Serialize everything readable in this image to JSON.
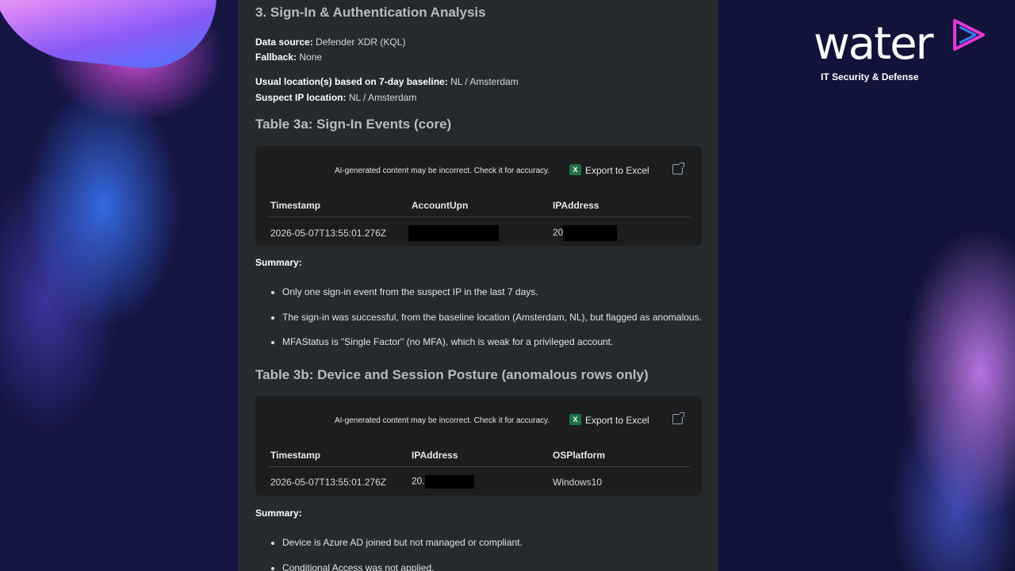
{
  "brand": {
    "wordmark": "water",
    "tagline": "IT Security & Defense",
    "colors": {
      "magenta": "#e33ad6",
      "blue": "#3a7bff"
    }
  },
  "report": {
    "section_title": "3. Sign-In & Authentication Analysis",
    "data_source": {
      "label": "Data source:",
      "value": "Defender XDR (KQL)"
    },
    "fallback": {
      "label": "Fallback:",
      "value": "None"
    },
    "usual_location": {
      "label": "Usual location(s) based on 7-day baseline:",
      "value": "NL / Amsterdam"
    },
    "suspect_location": {
      "label": "Suspect IP location:",
      "value": "NL / Amsterdam"
    },
    "table_a": {
      "title": "Table 3a: Sign-In Events (core)",
      "ai_note": "AI-generated content may be incorrect. Check it for accuracy.",
      "export_label": "Export to Excel",
      "columns": [
        "Timestamp",
        "AccountUpn",
        "IPAddress"
      ],
      "rows": [
        {
          "timestamp": "2026-05-07T13:55:01.276Z",
          "ip_prefix": "20"
        }
      ]
    },
    "summary_a": {
      "label": "Summary:",
      "items": [
        "Only one sign-in event from the suspect IP in the last 7 days.",
        "The sign-in was successful, from the baseline location (Amsterdam, NL), but flagged as anomalous.",
        "MFAStatus is \"Single Factor\" (no MFA), which is weak for a privileged account."
      ]
    },
    "table_b": {
      "title": "Table 3b: Device and Session Posture (anomalous rows only)",
      "ai_note": "AI-generated content may be incorrect. Check it for accuracy.",
      "export_label": "Export to Excel",
      "columns": [
        "Timestamp",
        "IPAddress",
        "OSPlatform"
      ],
      "rows": [
        {
          "timestamp": "2026-05-07T13:55:01.276Z",
          "ip_prefix": "20.",
          "os": "Windows10"
        }
      ]
    },
    "summary_b": {
      "label": "Summary:",
      "items": [
        "Device is Azure AD joined but not managed or compliant.",
        "Conditional Access was not applied."
      ]
    }
  }
}
